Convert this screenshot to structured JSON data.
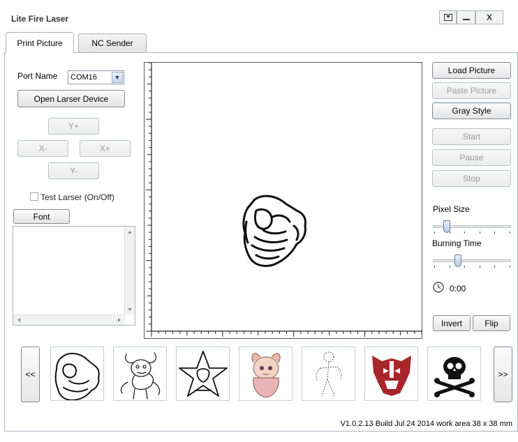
{
  "window": {
    "title": "Lite Fire Laser",
    "controls": {
      "menu": "▾",
      "minimize": "—",
      "close": "X"
    }
  },
  "tabs": [
    {
      "label": "Print Picture",
      "active": true
    },
    {
      "label": "NC Sender",
      "active": false
    }
  ],
  "left": {
    "port_label": "Port Name",
    "port_value": "COM16",
    "open_device": "Open Larser Device",
    "y_plus": "Y+",
    "x_minus": "X-",
    "x_plus": "X+",
    "y_minus": "Y-",
    "test_laser": "Test Larser (On/Off)",
    "font_button": "Font"
  },
  "right": {
    "load_picture": "Load Picture",
    "paste_picture": "Paste Picture",
    "gray_style": "Gray Style",
    "start": "Start",
    "pause": "Pause",
    "stop": "Stop",
    "pixel_size_label": "Pixel Size",
    "pixel_size_level": 0.15,
    "burning_time_label": "Burning Time",
    "burning_time_level": 0.3,
    "timer": "0:00",
    "invert": "Invert",
    "flip": "Flip"
  },
  "gallery": {
    "prev": "<<",
    "next": ">>",
    "items": [
      {
        "icon": "pointing-hand-icon"
      },
      {
        "icon": "cartoon-bull-icon"
      },
      {
        "icon": "star-emblem-icon"
      },
      {
        "icon": "anime-girl-icon"
      },
      {
        "icon": "dotted-figure-icon"
      },
      {
        "icon": "autobot-logo-icon",
        "color": "#a8262b"
      },
      {
        "icon": "skull-crossbones-icon"
      }
    ]
  },
  "status": "V1.0.2.13 Build Jul 24 2014 work area 38 x 38 mm"
}
